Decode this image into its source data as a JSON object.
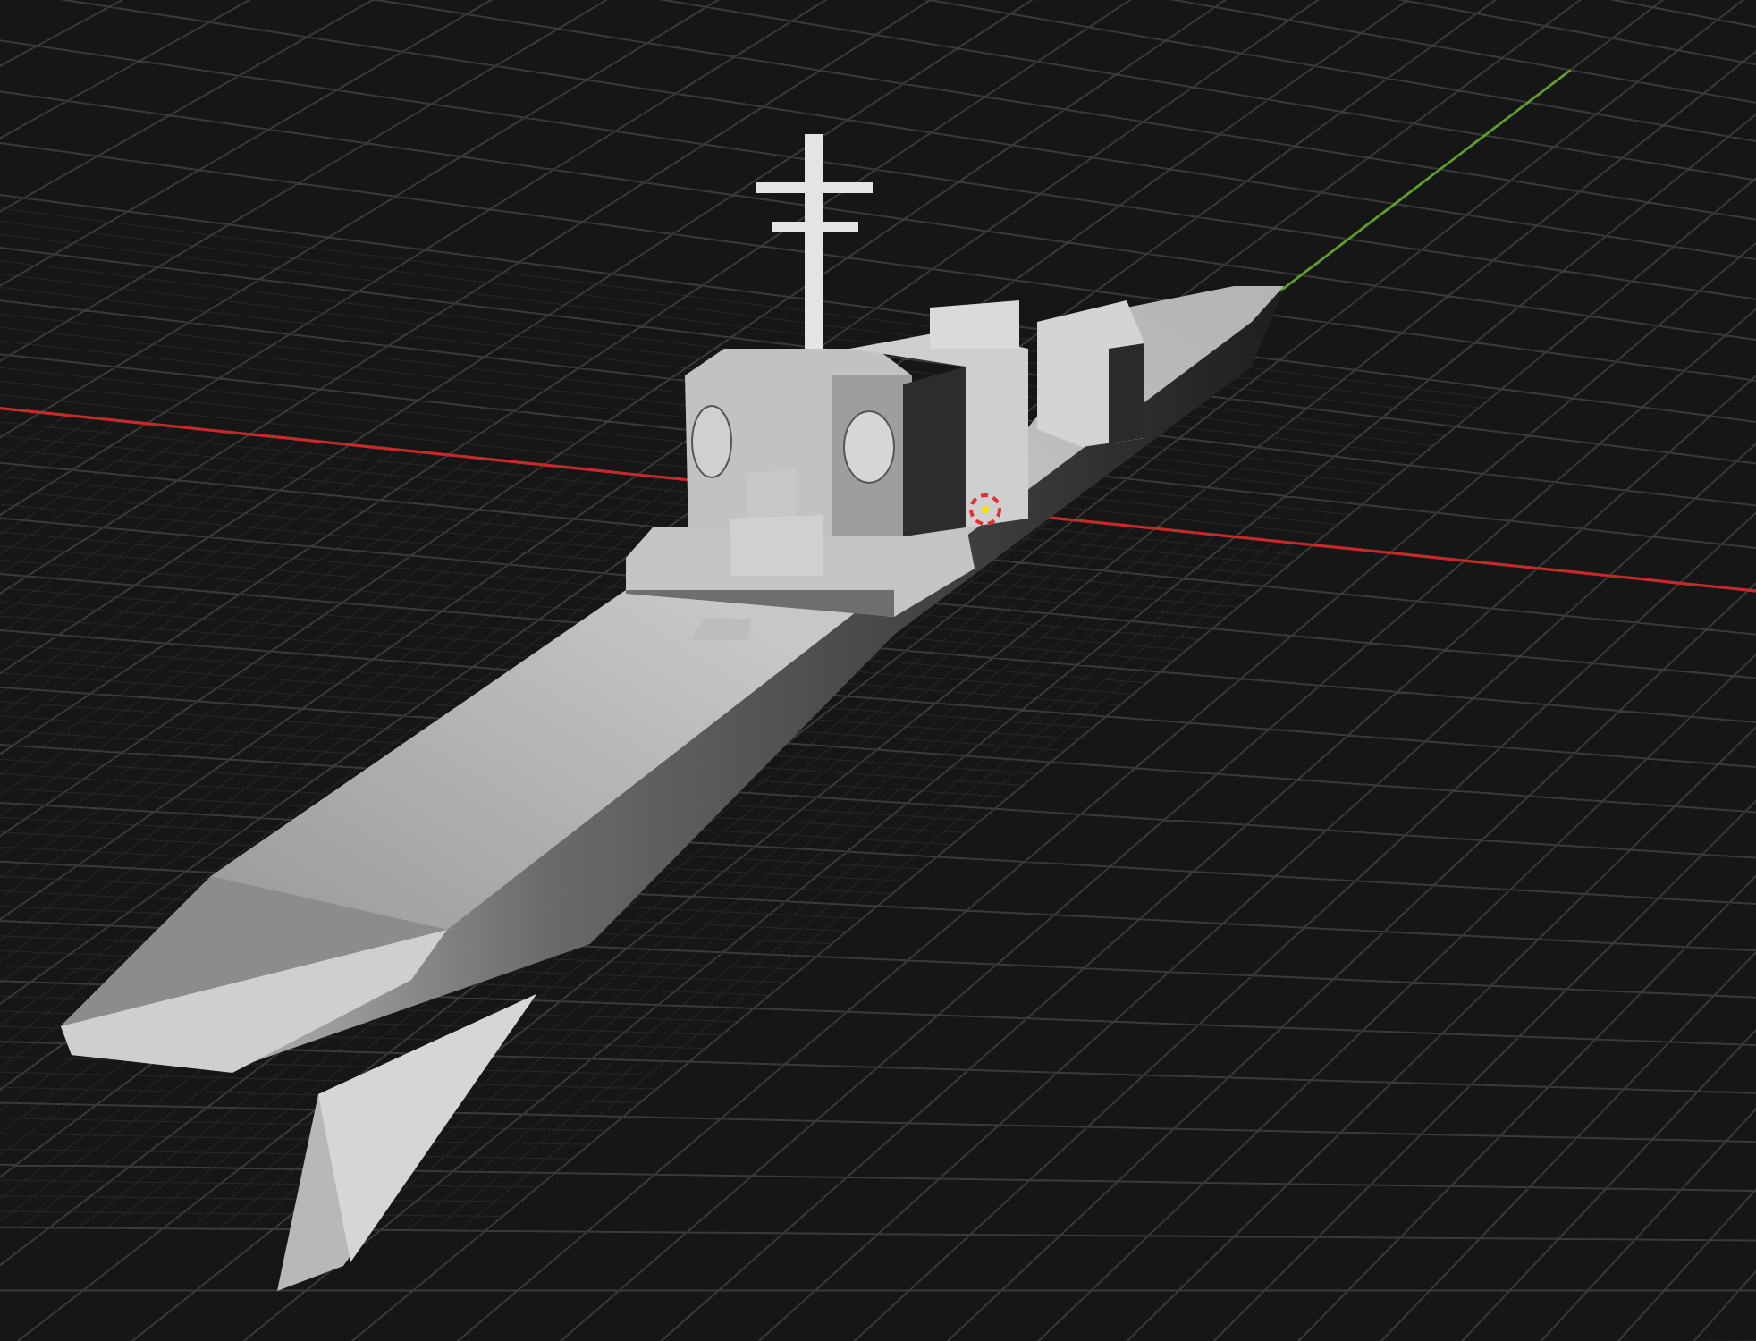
{
  "viewport": {
    "show_grid": true,
    "show_x_axis": true,
    "show_y_axis": true,
    "show_3d_cursor": true
  }
}
